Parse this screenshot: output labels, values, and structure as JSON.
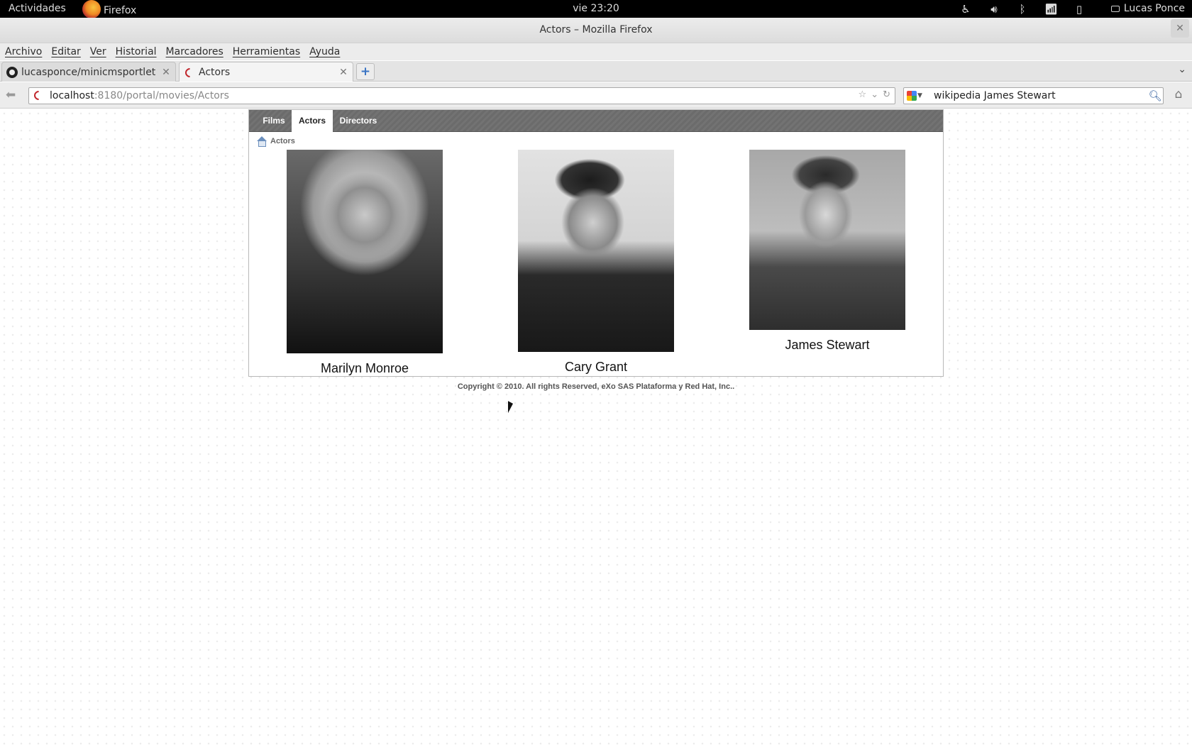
{
  "top_panel": {
    "activities": "Actividades",
    "app_name": "Firefox",
    "clock": "vie 23:20",
    "user": "Lucas Ponce",
    "icons": [
      "accessibility-icon",
      "volume-icon",
      "bluetooth-icon",
      "wifi-icon",
      "battery-icon"
    ]
  },
  "window": {
    "title": "Actors – Mozilla Firefox",
    "close_glyph": "✕"
  },
  "menu": {
    "items": [
      "Archivo",
      "Editar",
      "Ver",
      "Historial",
      "Marcadores",
      "Herramientas",
      "Ayuda"
    ]
  },
  "tabs": [
    {
      "label": "lucasponce/minicmsportlet",
      "icon": "github-icon"
    },
    {
      "label": "Actors",
      "icon": "portal-icon",
      "active": true
    }
  ],
  "navbar": {
    "url_host": "localhost",
    "url_path": ":8180/portal/movies/Actors",
    "search_value": "wikipedia James Stewart",
    "search_engine": "google-icon"
  },
  "portal": {
    "nav_items": [
      "Films",
      "Actors",
      "Directors"
    ],
    "active_nav": "Actors",
    "breadcrumb": "Actors",
    "actors": [
      {
        "name": "Marilyn Monroe"
      },
      {
        "name": "Cary Grant"
      },
      {
        "name": "James Stewart"
      }
    ],
    "footer": "Copyright © 2010. All rights Reserved, eXo SAS Plataforma y Red Hat, Inc.."
  },
  "colors": {
    "portal_nav_bg": "#6b6b6b",
    "active_tab_bg": "#ffffff",
    "panel_bg": "#000000"
  }
}
